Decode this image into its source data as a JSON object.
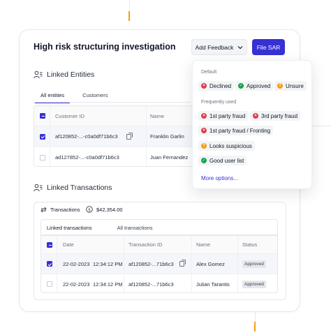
{
  "colors": {
    "accent": "#f59e0b",
    "primary": "#3730d4",
    "red": "#e23b4b",
    "green": "#16a34a",
    "orange": "#f59e0b"
  },
  "header": {
    "title": "High risk structuring investigation",
    "feedback_label": "Add Feedback",
    "sar_label": "File SAR"
  },
  "entities": {
    "heading": "Linked Entities",
    "tabs": [
      "All entities",
      "Customers"
    ],
    "columns": [
      "Customer ID",
      "Name"
    ],
    "rows": [
      {
        "id": "af120852-...-c0a0df71b6c3",
        "name": "Franklin Garlin",
        "checked": true
      },
      {
        "id": "ad127852-...-c0a0df71b6c3",
        "name": "Juan Fernandez",
        "checked": false
      }
    ]
  },
  "transactions": {
    "heading": "Linked Transactions",
    "stat_label": "Transactions",
    "stat_amount": "$42,354.00",
    "tabs": [
      "Linked transactions",
      "All transactions"
    ],
    "columns": [
      "Date",
      "Transaction ID",
      "Name",
      "Status"
    ],
    "rows": [
      {
        "date": "22-02-2023",
        "time": "12:34:12 PM",
        "txn_id": "af120852-...71b6c3",
        "name": "Alex Gomez",
        "status": "Approved",
        "checked": true
      },
      {
        "date": "22-02-2023",
        "time": "12:34:12 PM",
        "txn_id": "af120852-...71b6c3",
        "name": "Julian Tarantis",
        "status": "Approved",
        "checked": false
      }
    ]
  },
  "feedback_menu": {
    "default_label": "Default",
    "default_options": [
      {
        "label": "Declined",
        "icon": "x-circle-icon",
        "color": "#e23b4b"
      },
      {
        "label": "Approved",
        "icon": "check-circle-icon",
        "color": "#16a34a"
      },
      {
        "label": "Unsure",
        "icon": "question-circle-icon",
        "color": "#f59e0b"
      }
    ],
    "frequent_label": "Frequently used",
    "frequent_options": [
      {
        "label": "1st party fraud",
        "icon": "x-circle-icon",
        "color": "#e23b4b"
      },
      {
        "label": "3rd party fraud",
        "icon": "x-circle-icon",
        "color": "#e23b4b"
      },
      {
        "label": "1st party fraud / Fronting",
        "icon": "x-circle-icon",
        "color": "#e23b4b"
      },
      {
        "label": "Looks suspicious",
        "icon": "question-circle-icon",
        "color": "#f59e0b"
      },
      {
        "label": "Good user list",
        "icon": "check-circle-icon",
        "color": "#16a34a"
      }
    ],
    "more_label": "More options..."
  }
}
